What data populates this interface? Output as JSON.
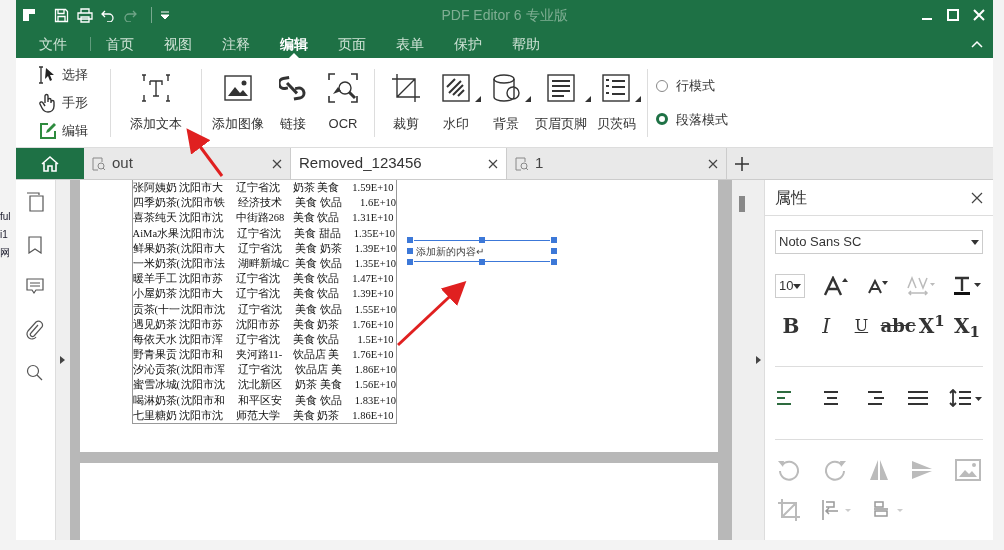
{
  "window": {
    "title": "PDF Editor 6 专业版"
  },
  "menu": [
    {
      "label": "文件",
      "selected": false
    },
    {
      "label": "首页",
      "selected": false
    },
    {
      "label": "视图",
      "selected": false
    },
    {
      "label": "注释",
      "selected": false
    },
    {
      "label": "编辑",
      "selected": true
    },
    {
      "label": "页面",
      "selected": false
    },
    {
      "label": "表单",
      "selected": false
    },
    {
      "label": "保护",
      "selected": false
    },
    {
      "label": "帮助",
      "selected": false
    }
  ],
  "mode_tools": [
    {
      "kind": "select",
      "label": "选择"
    },
    {
      "kind": "hand",
      "label": "手形"
    },
    {
      "kind": "edit",
      "label": "编辑"
    }
  ],
  "tools": [
    {
      "kind": "text",
      "label": "添加文本",
      "dropdown": false
    },
    {
      "kind": "image",
      "label": "添加图像",
      "dropdown": false
    },
    {
      "kind": "link",
      "label": "链接",
      "dropdown": false
    },
    {
      "kind": "ocr",
      "label": "OCR",
      "dropdown": false
    },
    {
      "kind": "crop",
      "label": "裁剪",
      "dropdown": false
    },
    {
      "kind": "watermark",
      "label": "水印",
      "dropdown": true
    },
    {
      "kind": "background",
      "label": "背景",
      "dropdown": true
    },
    {
      "kind": "header",
      "label": "页眉页脚",
      "dropdown": true
    },
    {
      "kind": "bates",
      "label": "贝茨码",
      "dropdown": true
    }
  ],
  "layout_modes": [
    {
      "label": "行模式",
      "selected": false
    },
    {
      "label": "段落模式",
      "selected": true
    }
  ],
  "tabs": [
    {
      "label": "out",
      "selected": false
    },
    {
      "label": "Removed_123456",
      "selected": true
    },
    {
      "label": "1",
      "selected": false
    }
  ],
  "table": {
    "rows": [
      [
        "张阿姨奶",
        "沈阳市大",
        "辽宁省沈",
        "奶茶 美食",
        "1.59E+10"
      ],
      [
        "四季奶茶(",
        "沈阳市铁",
        "经济技术",
        "美食 饮品",
        "1.6E+10"
      ],
      [
        "喜茶纯天",
        "沈阳市沈",
        "中街路268",
        "美食 饮品",
        "1.31E+10"
      ],
      [
        "AiMa水果",
        "沈阳市沈",
        "辽宁省沈",
        "美食 甜品",
        "1.35E+10"
      ],
      [
        "鲜果奶茶(",
        "沈阳市大",
        "辽宁省沈",
        "美食 奶茶",
        "1.39E+10"
      ],
      [
        "一米奶茶(",
        "沈阳市法",
        "湖畔新城C",
        "美食 饮品",
        "1.35E+10"
      ],
      [
        "暖羊手工",
        "沈阳市苏",
        "辽宁省沈",
        "美食 饮品",
        "1.47E+10"
      ],
      [
        "小屋奶茶",
        "沈阳市大",
        "辽宁省沈",
        "美食 饮品",
        "1.39E+10"
      ],
      [
        "贡茶(十一",
        "沈阳市沈",
        "辽宁省沈",
        "美食 饮品",
        "1.55E+10"
      ],
      [
        "遇见奶茶",
        "沈阳市苏",
        "沈阳市苏",
        "美食 奶茶",
        "1.76E+10"
      ],
      [
        "每依天水",
        "沈阳市浑",
        "辽宁省沈",
        "美食 饮品",
        "1.5E+10"
      ],
      [
        "野青果贡",
        "沈阳市和",
        "夹河路11-",
        "饮品店 美",
        "1.76E+10"
      ],
      [
        "汐沁贡茶(",
        "沈阳市浑",
        "辽宁省沈",
        "饮品店 美",
        "1.86E+10"
      ],
      [
        "蜜雪冰城(",
        "沈阳市沈",
        "沈北新区",
        "奶茶 美食",
        "1.56E+10"
      ],
      [
        "喝淋奶茶(",
        "沈阳市和",
        "和平区安",
        "美食 饮品",
        "1.83E+10"
      ],
      [
        "七里糖奶",
        "沈阳市沈",
        "师范大学",
        "美食 奶茶",
        "1.86E+10"
      ]
    ]
  },
  "text_box": {
    "value": "添加新的内容↵"
  },
  "properties": {
    "title": "属性",
    "font": "Noto Sans SC",
    "size": "10",
    "format": [
      {
        "kind": "bold",
        "label": "B"
      },
      {
        "kind": "italic",
        "label": "I"
      },
      {
        "kind": "underline",
        "label": "U"
      },
      {
        "kind": "strike",
        "label": "abc"
      },
      {
        "kind": "super",
        "label": "X$^{1}$"
      },
      {
        "kind": "sub",
        "label": "X$_{1}$"
      }
    ],
    "alignments": [
      {
        "kind": "left",
        "selected": true
      },
      {
        "kind": "center",
        "selected": false
      },
      {
        "kind": "right",
        "selected": false
      },
      {
        "kind": "justify",
        "selected": false
      }
    ]
  },
  "background_fragments": [
    "ful",
    "i1",
    "网"
  ]
}
